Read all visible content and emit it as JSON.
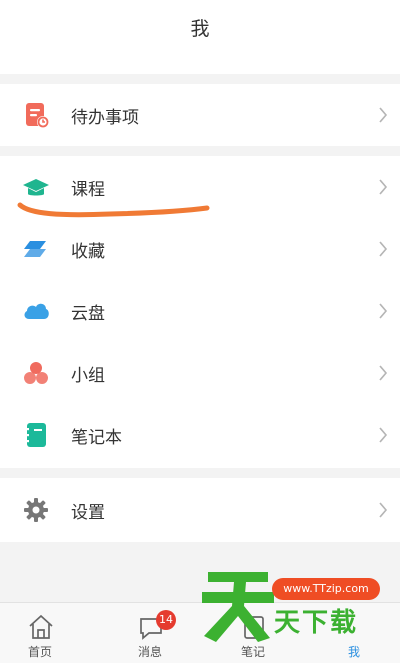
{
  "header": {
    "title": "我"
  },
  "menu": {
    "todo": "待办事项",
    "course": "课程",
    "favorites": "收藏",
    "cloud": "云盘",
    "group": "小组",
    "notebook": "笔记本",
    "settings": "设置"
  },
  "tabbar": {
    "home": "首页",
    "messages": "消息",
    "messages_badge": "14",
    "notes": "笔记",
    "me": "我"
  },
  "watermark": {
    "url": "www.TTzip.com",
    "text": "天下载"
  },
  "colors": {
    "course_icon": "#1fb58f",
    "favorites_icon": "#2a8fe0",
    "cloud_icon": "#3aa1e6",
    "group_icon": "#f06b5e",
    "notebook_icon": "#1cb99a",
    "todo_icon": "#f16b5b",
    "annotation": "#f07a35",
    "active_tab": "#2a8fe0"
  }
}
